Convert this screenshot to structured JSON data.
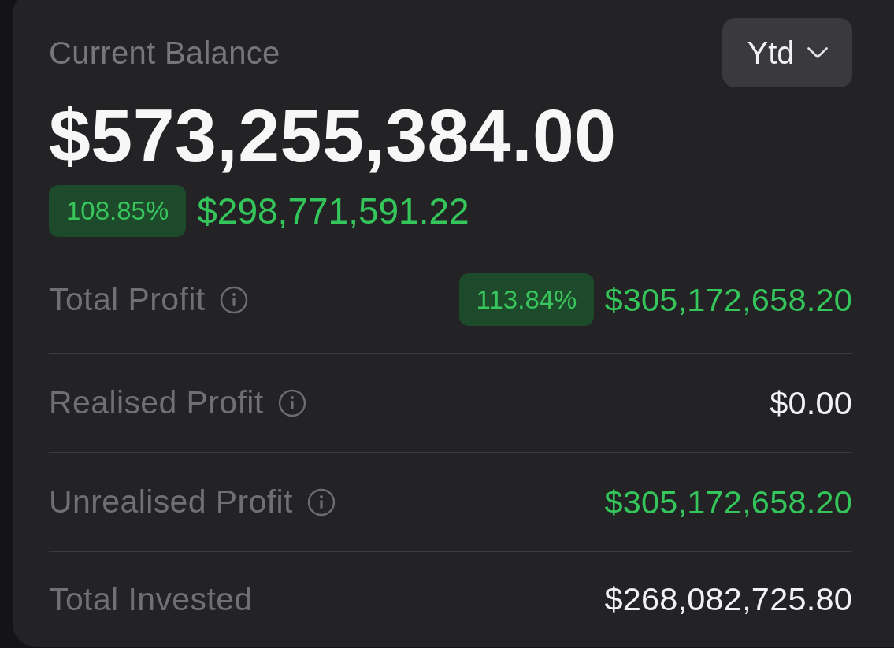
{
  "balance": {
    "label": "Current Balance",
    "amount": "$573,255,384.00",
    "change": {
      "percent": "108.85%",
      "amount": "$298,771,591.22",
      "positive": true
    }
  },
  "period_selector": {
    "value": "Ytd"
  },
  "rows": [
    {
      "label": "Total Profit",
      "info": true,
      "percent": "113.84%",
      "value": "$305,172,658.20",
      "positive": true
    },
    {
      "label": "Realised Profit",
      "info": true,
      "value": "$0.00",
      "positive": false
    },
    {
      "label": "Unrealised Profit",
      "info": true,
      "value": "$305,172,658.20",
      "positive": true
    },
    {
      "label": "Total Invested",
      "info": false,
      "value": "$268,082,725.80",
      "positive": false
    }
  ]
}
